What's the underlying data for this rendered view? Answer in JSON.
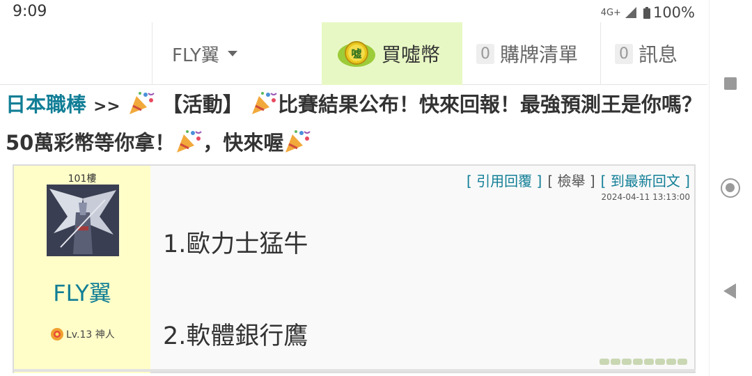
{
  "status_bar": {
    "time": "9:09",
    "network": "4G+",
    "battery": "100%"
  },
  "nav": {
    "user": "FLY翼",
    "buy_coins": "買噓幣",
    "coin_logo_text": "噓",
    "shopping_list": {
      "count": "0",
      "label": "購牌清單"
    },
    "messages": {
      "count": "0",
      "label": "訊息"
    }
  },
  "thread": {
    "board": "日本職棒",
    "separator": ">>",
    "title_part1": "【活動】",
    "title_part2": "比賽結果公布！快來回報！最強預測王是你嗎？50萬彩幣等你拿！",
    "title_part3": "，快來喔"
  },
  "post": {
    "floor": "101樓",
    "poster": "FLY翼",
    "level": "Lv.13 神人",
    "actions": {
      "quote": "引用回覆",
      "report": "檢舉",
      "latest": "到最新回文"
    },
    "timestamp": "2024-04-11 13:13:00",
    "lines": [
      "1.歐力士猛牛",
      "2.軟體銀行鷹"
    ]
  },
  "colors": {
    "link": "#117e96",
    "buy_bg": "#e8f8c4",
    "sidebar_bg": "#fffec9",
    "post_bg": "#f9f9f9"
  }
}
